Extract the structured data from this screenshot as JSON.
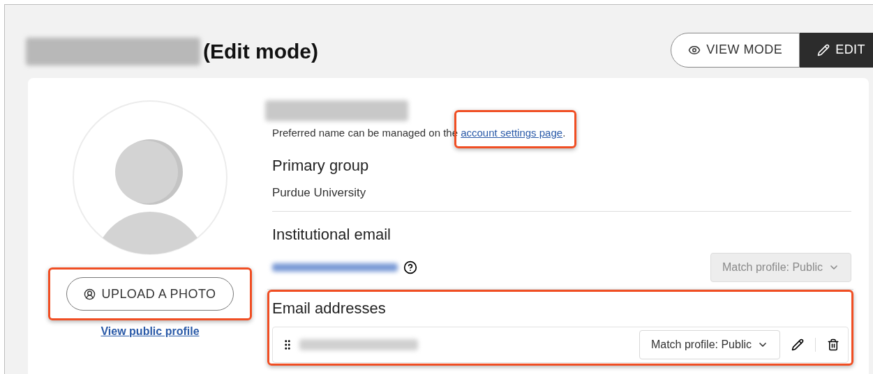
{
  "header": {
    "title": "(Edit mode)"
  },
  "mode_toggle": [
    {
      "label": "VIEW MODE",
      "selected": false,
      "kind": "view"
    },
    {
      "label": "EDIT",
      "selected": true,
      "kind": "edit"
    }
  ],
  "profile": {
    "upload_button": "UPLOAD A PHOTO",
    "public_link": "View public profile"
  },
  "name_section": {
    "note": "Preferred name can be managed on the ",
    "link": "account settings page",
    "note_end": "."
  },
  "primary_group": {
    "heading": "Primary group",
    "value": "Purdue University"
  },
  "institutional_email": {
    "heading": "Institutional email",
    "visibility": "Match profile: Public",
    "disabled": true
  },
  "email_addresses": {
    "heading": "Email addresses",
    "rows": [
      {
        "visibility": "Match profile: Public"
      }
    ]
  }
}
